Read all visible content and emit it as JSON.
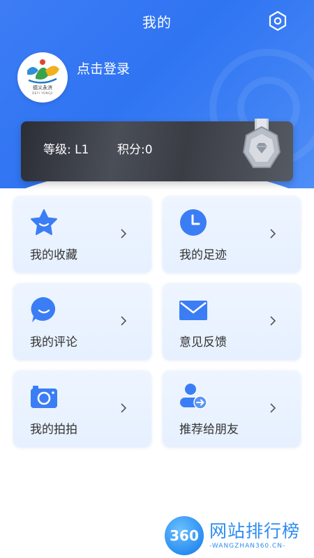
{
  "header": {
    "title": "我的",
    "settings_icon": "hexagon-settings-icon"
  },
  "profile": {
    "login_label": "点击登录",
    "avatar_logo_text": "德义永济",
    "avatar_logo_sub": "DEYI YONGJI"
  },
  "level_card": {
    "level_text": "等级: L1",
    "points_text": "积分:0",
    "medal_icon": "silver-medal-icon"
  },
  "menu": {
    "items": [
      {
        "label": "我的收藏",
        "icon": "star-icon"
      },
      {
        "label": "我的足迹",
        "icon": "clock-icon"
      },
      {
        "label": "我的评论",
        "icon": "chat-bubble-icon"
      },
      {
        "label": "意见反馈",
        "icon": "envelope-icon"
      },
      {
        "label": "我的拍拍",
        "icon": "camera-icon"
      },
      {
        "label": "推荐给朋友",
        "icon": "share-user-icon"
      }
    ]
  },
  "watermark": {
    "logo_text": "360",
    "title": "网站排行榜",
    "domain": "-WANGZHAN360.CN-"
  },
  "colors": {
    "header_blue": "#2f74f2",
    "icon_blue": "#3b7df5",
    "tile_bg": "#eef5ff",
    "label_text": "#333333"
  }
}
